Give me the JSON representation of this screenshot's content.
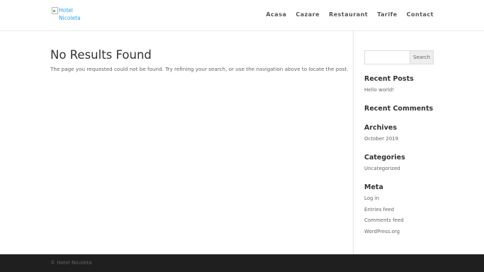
{
  "header": {
    "logo_alt": "Hotel Nicoleta",
    "nav": [
      "Acasa",
      "Cazare",
      "Restaurant",
      "Tarife",
      "Contact"
    ]
  },
  "main": {
    "title": "No Results Found",
    "message": "The page you requested could not be found. Try refining your search, or use the navigation above to locate the post."
  },
  "sidebar": {
    "search": {
      "placeholder": "",
      "button_label": "Search"
    },
    "recent_posts": {
      "title": "Recent Posts",
      "items": [
        "Hello world!"
      ]
    },
    "recent_comments": {
      "title": "Recent Comments"
    },
    "archives": {
      "title": "Archives",
      "items": [
        "October 2019"
      ]
    },
    "categories": {
      "title": "Categories",
      "items": [
        "Uncategorized"
      ]
    },
    "meta": {
      "title": "Meta",
      "items": [
        "Log in",
        "Entries feed",
        "Comments feed",
        "WordPress.org"
      ]
    }
  },
  "footer": {
    "copyright": "© Hotel Nicoleta"
  },
  "colors": {
    "link": "#2ea3f2",
    "footer_bg": "#1f1f1f",
    "text": "#666666",
    "heading": "#333333"
  },
  "icons": {
    "logo": "broken-image-icon"
  }
}
